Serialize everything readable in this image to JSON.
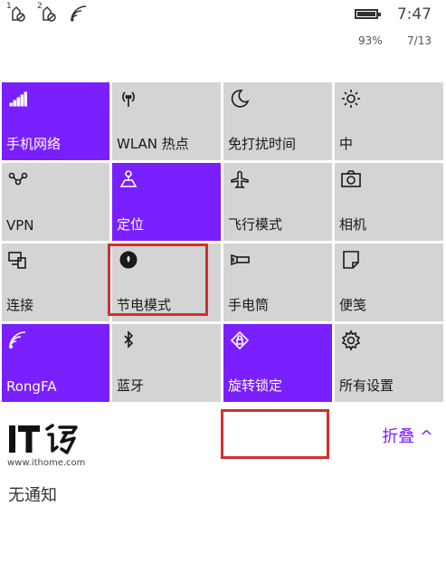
{
  "status": {
    "sim1_label": "1",
    "sim2_label": "2",
    "battery_level": 0.93,
    "battery_percent": "93%",
    "time": "7:47",
    "date": "7/13"
  },
  "tiles": [
    {
      "label": "手机网络",
      "icon": "cellular-signal-icon",
      "active": true
    },
    {
      "label": "WLAN 热点",
      "icon": "wifi-hotspot-icon",
      "active": false
    },
    {
      "label": "免打扰时间",
      "icon": "moon-icon",
      "active": false
    },
    {
      "label": "中",
      "icon": "brightness-icon",
      "active": false
    },
    {
      "label": "VPN",
      "icon": "vpn-icon",
      "active": false
    },
    {
      "label": "定位",
      "icon": "location-icon",
      "active": true
    },
    {
      "label": "飞行模式",
      "icon": "airplane-icon",
      "active": false
    },
    {
      "label": "相机",
      "icon": "camera-icon",
      "active": false
    },
    {
      "label": "连接",
      "icon": "connect-icon",
      "active": false
    },
    {
      "label": "节电模式",
      "icon": "battery-saver-icon",
      "active": false
    },
    {
      "label": "手电筒",
      "icon": "flashlight-icon",
      "active": false
    },
    {
      "label": "便笺",
      "icon": "note-icon",
      "active": false
    },
    {
      "label": "RongFA",
      "icon": "wifi-icon",
      "active": true
    },
    {
      "label": "蓝牙",
      "icon": "bluetooth-icon",
      "active": false
    },
    {
      "label": "旋转锁定",
      "icon": "rotation-lock-icon",
      "active": true
    },
    {
      "label": "所有设置",
      "icon": "settings-gear-icon",
      "active": false
    }
  ],
  "watermark": {
    "url": "www.ithome.com"
  },
  "collapse_label": "折叠 ^",
  "no_notifications": "无通知",
  "colors": {
    "accent": "#7a1fff",
    "tile_inactive": "#d4d4d4",
    "highlight": "#d32f2f"
  }
}
